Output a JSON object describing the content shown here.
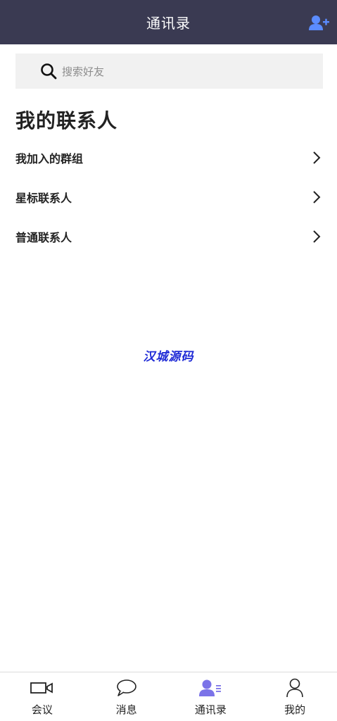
{
  "header": {
    "title": "通讯录",
    "add_contact_icon": "add-user-icon",
    "background": "#3a3a52",
    "icon_color": "#5b8cff"
  },
  "search": {
    "placeholder": "搜索好友",
    "icon": "search-icon"
  },
  "section": {
    "title": "我的联系人"
  },
  "list": {
    "items": [
      {
        "label": "我加入的群组",
        "icon": "chevron-right-icon"
      },
      {
        "label": "星标联系人",
        "icon": "chevron-right-icon"
      },
      {
        "label": "普通联系人",
        "icon": "chevron-right-icon"
      }
    ]
  },
  "watermark": {
    "text": "汉城源码",
    "color": "#1f2bd6"
  },
  "tabbar": {
    "active_color": "#7b73e8",
    "tabs": [
      {
        "label": "会议",
        "icon": "video-camera-icon",
        "active": false
      },
      {
        "label": "消息",
        "icon": "chat-bubble-icon",
        "active": false
      },
      {
        "label": "通讯录",
        "icon": "contacts-icon",
        "active": true
      },
      {
        "label": "我的",
        "icon": "person-icon",
        "active": false
      }
    ]
  }
}
